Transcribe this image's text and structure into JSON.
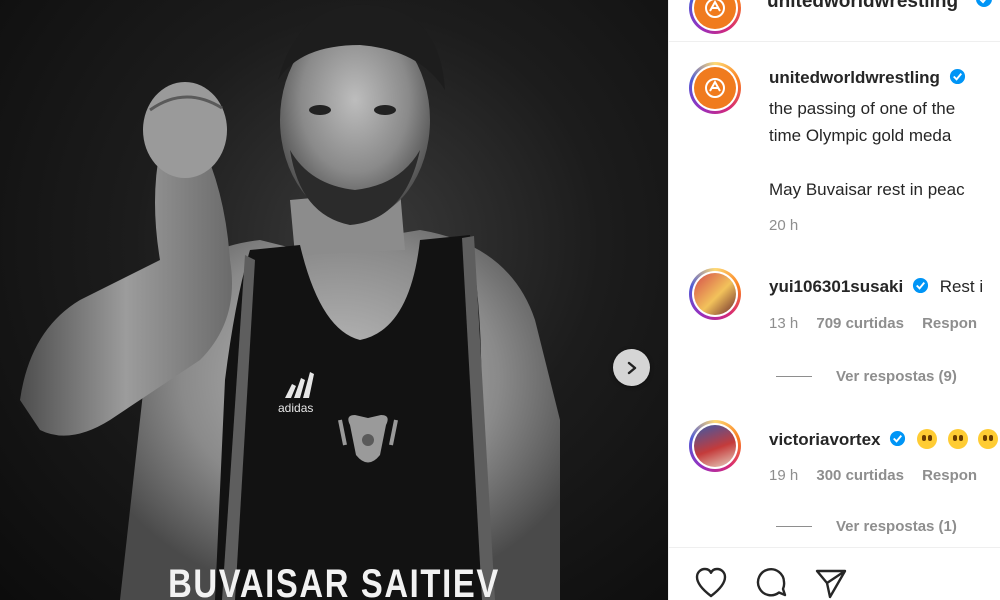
{
  "post": {
    "caption_overlay": "BUVAISAR SAITIEV",
    "shirt_brand": "adidas"
  },
  "account": {
    "username": "unitedworldwrestling",
    "username_top": "unitedworldwrestling"
  },
  "caption": {
    "line1_tail": "",
    "line2": "the passing of one of the",
    "line3": "time Olympic gold meda",
    "line4": "May Buvaisar rest in peac",
    "time": "20 h"
  },
  "comments": [
    {
      "username": "yui106301susaki",
      "text": "Rest i",
      "time": "13 h",
      "likes": "709 curtidas",
      "reply": "Respon",
      "view_replies": "Ver respostas (9)"
    },
    {
      "username": "victoriavortex",
      "text": "",
      "time": "19 h",
      "likes": "300 curtidas",
      "reply": "Respon",
      "view_replies": "Ver respostas (1)"
    }
  ],
  "icons": {
    "next": "chevron-right-icon",
    "like": "heart-icon",
    "comment": "comment-icon",
    "share": "paper-plane-icon",
    "verified": "verified-badge-icon"
  },
  "colors": {
    "verified": "#0095f6",
    "uww_orange": "#f07b1e",
    "muted_text": "#8e8e8e"
  }
}
